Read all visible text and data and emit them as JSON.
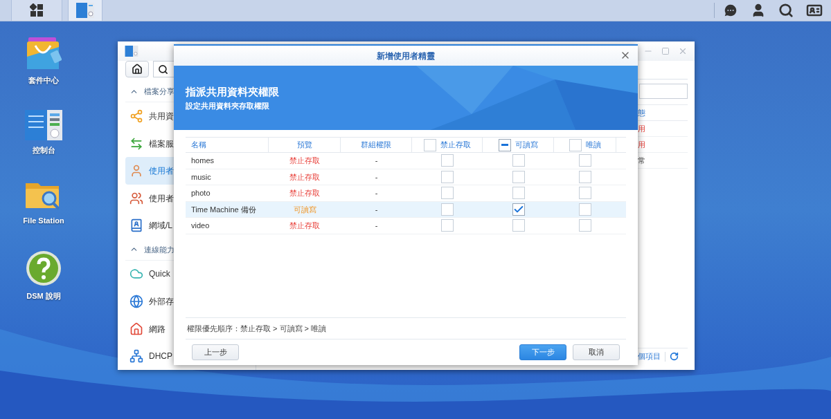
{
  "taskbar": {
    "buttons": [
      {
        "kind": "main-menu",
        "selected": false
      },
      {
        "kind": "control-panel",
        "selected": true
      }
    ]
  },
  "desktop_icons": [
    {
      "kind": "package",
      "label": "套件中心"
    },
    {
      "kind": "control-panel",
      "label": "控制台"
    },
    {
      "kind": "folder",
      "label": "File Station"
    },
    {
      "kind": "help",
      "label": "DSM 說明"
    }
  ],
  "control_panel": {
    "sidebar": [
      {
        "kind": "section",
        "label": "檔案分享",
        "expanded": true
      },
      {
        "kind": "item",
        "label": "共用資",
        "selected": false
      },
      {
        "kind": "item",
        "label": "檔案服",
        "selected": false
      },
      {
        "kind": "item",
        "label": "使用者",
        "selected": true
      },
      {
        "kind": "item",
        "label": "使用者",
        "selected": false
      },
      {
        "kind": "item",
        "label": "網域/L",
        "selected": false
      },
      {
        "kind": "section",
        "label": "連線能力",
        "expanded": true
      },
      {
        "kind": "item",
        "label": "Quick",
        "selected": false
      },
      {
        "kind": "item",
        "label": "外部存",
        "selected": false
      },
      {
        "kind": "item",
        "label": "網路",
        "selected": false
      },
      {
        "kind": "item",
        "label": "DHCP",
        "selected": false
      }
    ],
    "table": {
      "column_header": "態",
      "rows": [
        {
          "text": "用",
          "kind": "alert"
        },
        {
          "text": "用",
          "kind": "alert"
        },
        {
          "text": "常",
          "kind": "normal"
        }
      ]
    },
    "footer": "個項目"
  },
  "dialog": {
    "title": "新增使用者精靈",
    "heading": "指派共用資料夾權限",
    "subheading": "設定共用資料夾存取權限",
    "columns": [
      {
        "label": "名稱",
        "kind": "text"
      },
      {
        "label": "預覽",
        "kind": "text"
      },
      {
        "label": "群組權限",
        "kind": "text"
      },
      {
        "label": "禁止存取",
        "kind": "checkbox",
        "checked": false
      },
      {
        "label": "可讀寫",
        "kind": "checkbox",
        "indeterminate": true
      },
      {
        "label": "唯讀",
        "kind": "checkbox",
        "checked": false
      }
    ],
    "rows": [
      {
        "name": "homes",
        "preview": {
          "text": "禁止存取",
          "kind": "deny"
        },
        "group": "-",
        "deny": false,
        "read_write": false,
        "read_only": false,
        "selected": false
      },
      {
        "name": "music",
        "preview": {
          "text": "禁止存取",
          "kind": "deny"
        },
        "group": "-",
        "deny": false,
        "read_write": false,
        "read_only": false,
        "selected": false
      },
      {
        "name": "photo",
        "preview": {
          "text": "禁止存取",
          "kind": "deny"
        },
        "group": "-",
        "deny": false,
        "read_write": false,
        "read_only": false,
        "selected": false
      },
      {
        "name": "Time Machine 備份",
        "preview": {
          "text": "可讀寫",
          "kind": "read_write"
        },
        "group": "-",
        "deny": false,
        "read_write": true,
        "read_only": false,
        "selected": true
      },
      {
        "name": "video",
        "preview": {
          "text": "禁止存取",
          "kind": "deny"
        },
        "group": "-",
        "deny": false,
        "read_write": false,
        "read_only": false,
        "selected": false
      }
    ],
    "note": "權限優先順序：禁止存取 > 可讀寫 > 唯讀",
    "buttons": [
      {
        "label": "上一步",
        "kind": "default"
      },
      {
        "label": "下一步",
        "kind": "primary"
      },
      {
        "label": "取消",
        "kind": "default"
      }
    ]
  }
}
